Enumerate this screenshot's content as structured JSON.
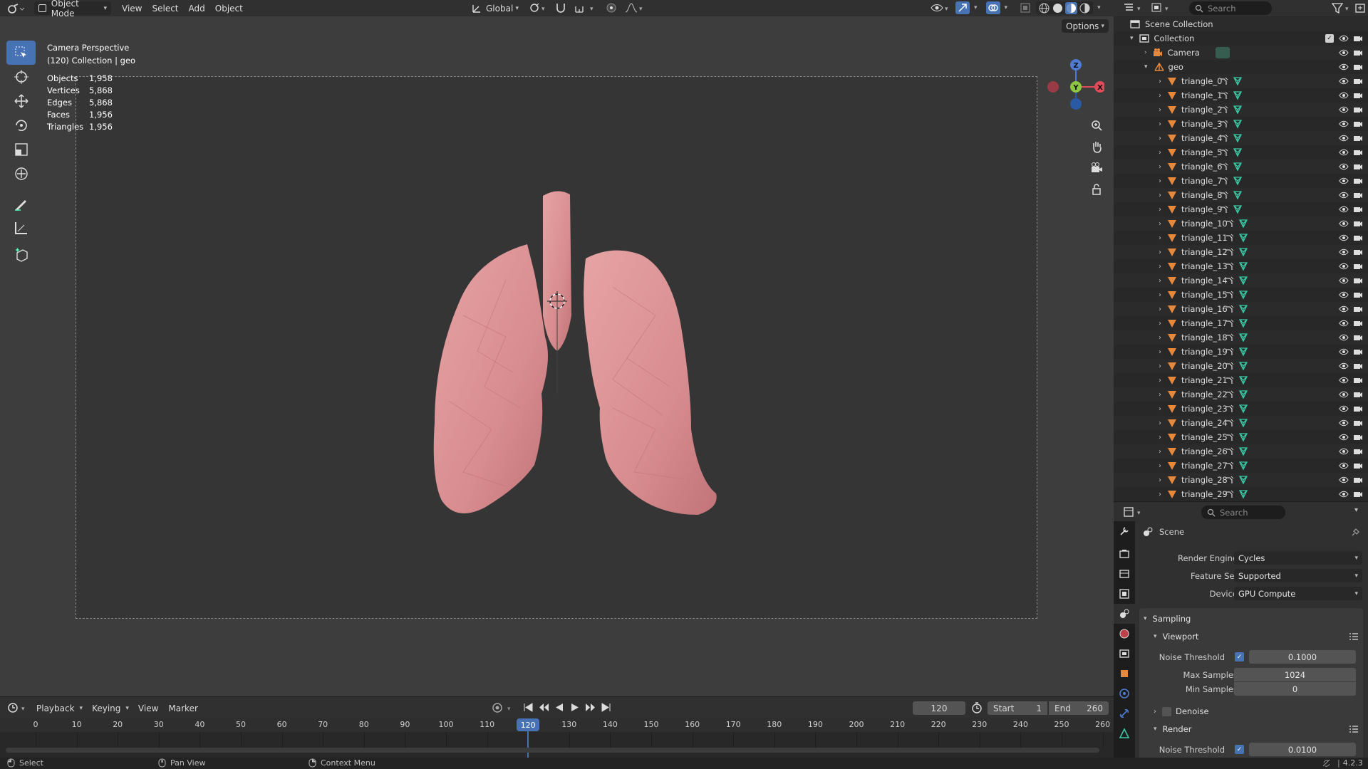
{
  "header": {
    "mode": "Object Mode",
    "menus": [
      "View",
      "Select",
      "Add",
      "Object"
    ],
    "transform_orientation": "Global",
    "options_label": "Options"
  },
  "viewport": {
    "camera_label": "Camera Perspective",
    "collection_label": "(120) Collection | geo",
    "stats": [
      {
        "label": "Objects",
        "value": "1,958"
      },
      {
        "label": "Vertices",
        "value": "5,868"
      },
      {
        "label": "Edges",
        "value": "5,868"
      },
      {
        "label": "Faces",
        "value": "1,956"
      },
      {
        "label": "Triangles",
        "value": "1,956"
      }
    ],
    "gizmo_axes": {
      "z": "Z",
      "y": "Y",
      "x": "X"
    }
  },
  "outliner": {
    "search_placeholder": "Search",
    "scene_collection": "Scene Collection",
    "collection": "Collection",
    "camera": "Camera",
    "geo": "geo",
    "items": [
      "triangle_0",
      "triangle_1",
      "triangle_2",
      "triangle_3",
      "triangle_4",
      "triangle_5",
      "triangle_6",
      "triangle_7",
      "triangle_8",
      "triangle_9",
      "triangle_10",
      "triangle_11",
      "triangle_12",
      "triangle_13",
      "triangle_14",
      "triangle_15",
      "triangle_16",
      "triangle_17",
      "triangle_18",
      "triangle_19",
      "triangle_20",
      "triangle_21",
      "triangle_22",
      "triangle_23",
      "triangle_24",
      "triangle_25",
      "triangle_26",
      "triangle_27",
      "triangle_28",
      "triangle_29"
    ]
  },
  "properties": {
    "search_placeholder": "Search",
    "context": "Scene",
    "render_engine_label": "Render Engine",
    "render_engine": "Cycles",
    "feature_set_label": "Feature Set",
    "feature_set": "Supported",
    "device_label": "Device",
    "device": "GPU Compute",
    "sampling": "Sampling",
    "viewport": "Viewport",
    "noise_threshold_label": "Noise Threshold",
    "viewport_noise_threshold": "0.1000",
    "max_samples_label": "Max Samples",
    "max_samples": "1024",
    "min_samples_label": "Min Samples",
    "min_samples": "0",
    "denoise": "Denoise",
    "render": "Render",
    "render_noise_threshold": "0.0100"
  },
  "timeline": {
    "menus": [
      "Playback",
      "Keying",
      "View",
      "Marker"
    ],
    "current_frame": "120",
    "start_label": "Start",
    "start": "1",
    "end_label": "End",
    "end": "260",
    "ticks": [
      "0",
      "10",
      "20",
      "30",
      "40",
      "50",
      "60",
      "70",
      "80",
      "90",
      "100",
      "110",
      "120",
      "130",
      "140",
      "150",
      "160",
      "170",
      "180",
      "190",
      "200",
      "210",
      "220",
      "230",
      "240",
      "250",
      "260"
    ]
  },
  "statusbar": {
    "select": "Select",
    "pan_view": "Pan View",
    "context_menu": "Context Menu",
    "version": "4.2.3"
  },
  "colors": {
    "accent": "#4772b3",
    "mesh_icon": "#e8883a",
    "data_icon": "#3bc9a7",
    "lung": "#d88d90"
  }
}
